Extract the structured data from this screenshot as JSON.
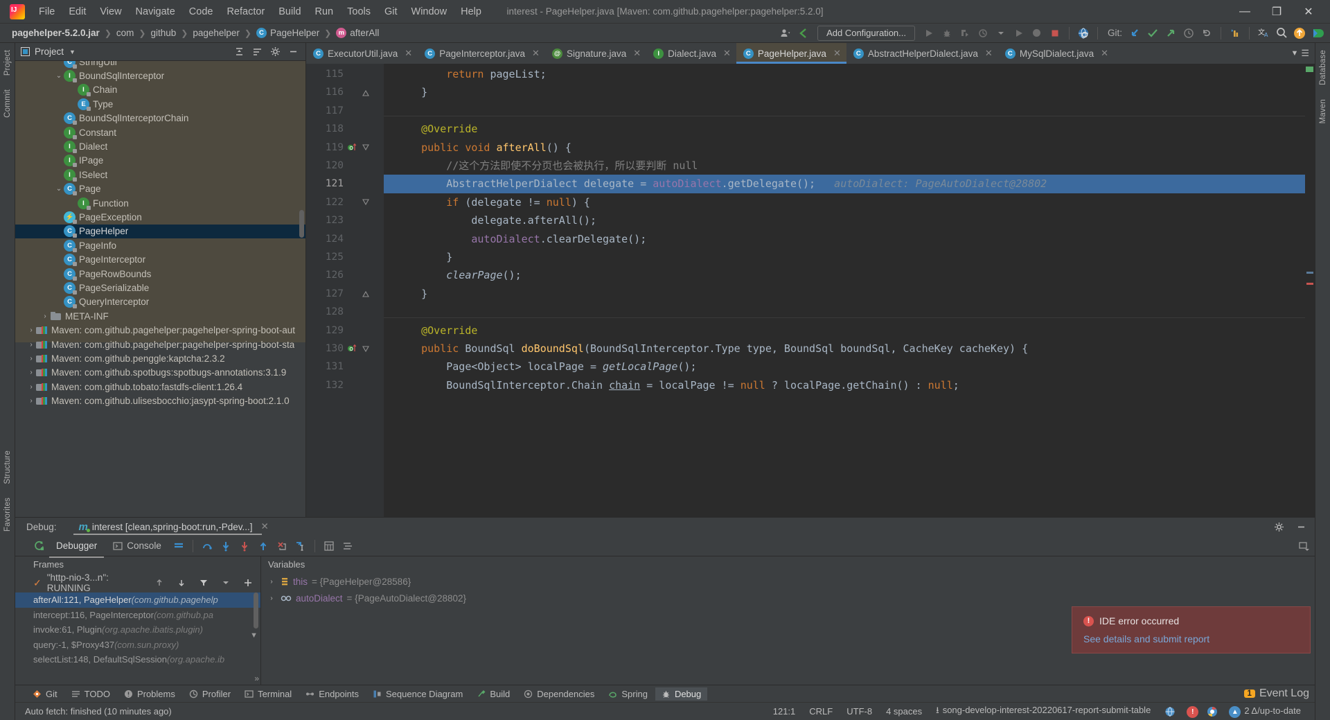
{
  "window": {
    "title": "interest - PageHelper.java [Maven: com.github.pagehelper:pagehelper:5.2.0]",
    "minimize": "—",
    "maximize": "❐",
    "close": "✕"
  },
  "menu": [
    "File",
    "Edit",
    "View",
    "Navigate",
    "Code",
    "Refactor",
    "Build",
    "Run",
    "Tools",
    "Git",
    "Window",
    "Help"
  ],
  "breadcrumb": [
    {
      "label": "pagehelper-5.2.0.jar",
      "icon": "none",
      "bold": true
    },
    {
      "label": "com",
      "icon": "none",
      "bold": false
    },
    {
      "label": "github",
      "icon": "none",
      "bold": false
    },
    {
      "label": "pagehelper",
      "icon": "none",
      "bold": false
    },
    {
      "label": "PageHelper",
      "icon": "class",
      "bold": false
    },
    {
      "label": "afterAll",
      "icon": "method",
      "bold": false
    }
  ],
  "toolbar": {
    "add_configuration": "Add Configuration...",
    "git_label": "Git:"
  },
  "project_panel": {
    "title": "Project",
    "tree": [
      {
        "label": "StringUtil",
        "indent": 3,
        "icon": "C",
        "arrow": "",
        "selected": false,
        "clipped": true
      },
      {
        "label": "BoundSqlInterceptor",
        "indent": 3,
        "icon": "I",
        "arrow": "v",
        "selected": false
      },
      {
        "label": "Chain",
        "indent": 4,
        "icon": "I",
        "arrow": "",
        "selected": false
      },
      {
        "label": "Type",
        "indent": 4,
        "icon": "E",
        "arrow": "",
        "selected": false
      },
      {
        "label": "BoundSqlInterceptorChain",
        "indent": 3,
        "icon": "C",
        "arrow": "",
        "selected": false
      },
      {
        "label": "Constant",
        "indent": 3,
        "icon": "I",
        "arrow": "",
        "selected": false
      },
      {
        "label": "Dialect",
        "indent": 3,
        "icon": "I",
        "arrow": "",
        "selected": false
      },
      {
        "label": "IPage",
        "indent": 3,
        "icon": "I",
        "arrow": "",
        "selected": false
      },
      {
        "label": "ISelect",
        "indent": 3,
        "icon": "I",
        "arrow": "",
        "selected": false
      },
      {
        "label": "Page",
        "indent": 3,
        "icon": "C",
        "arrow": "v",
        "selected": false
      },
      {
        "label": "Function",
        "indent": 4,
        "icon": "I",
        "arrow": "",
        "selected": false
      },
      {
        "label": "PageException",
        "indent": 3,
        "icon": "X",
        "arrow": "",
        "selected": false
      },
      {
        "label": "PageHelper",
        "indent": 3,
        "icon": "C",
        "arrow": "",
        "selected": true
      },
      {
        "label": "PageInfo",
        "indent": 3,
        "icon": "C",
        "arrow": "",
        "selected": false
      },
      {
        "label": "PageInterceptor",
        "indent": 3,
        "icon": "C",
        "arrow": "",
        "selected": false
      },
      {
        "label": "PageRowBounds",
        "indent": 3,
        "icon": "C",
        "arrow": "",
        "selected": false
      },
      {
        "label": "PageSerializable",
        "indent": 3,
        "icon": "C",
        "arrow": "",
        "selected": false
      },
      {
        "label": "QueryInterceptor",
        "indent": 3,
        "icon": "C",
        "arrow": "",
        "selected": false
      },
      {
        "label": "META-INF",
        "indent": 2,
        "icon": "folder",
        "arrow": ">",
        "selected": false
      },
      {
        "label": "Maven: com.github.pagehelper:pagehelper-spring-boot-aut",
        "indent": 1,
        "icon": "maven",
        "arrow": ">",
        "selected": false
      },
      {
        "label": "Maven: com.github.pagehelper:pagehelper-spring-boot-sta",
        "indent": 1,
        "icon": "maven",
        "arrow": ">",
        "selected": false
      },
      {
        "label": "Maven: com.github.penggle:kaptcha:2.3.2",
        "indent": 1,
        "icon": "maven",
        "arrow": ">",
        "selected": false
      },
      {
        "label": "Maven: com.github.spotbugs:spotbugs-annotations:3.1.9",
        "indent": 1,
        "icon": "maven",
        "arrow": ">",
        "selected": false
      },
      {
        "label": "Maven: com.github.tobato:fastdfs-client:1.26.4",
        "indent": 1,
        "icon": "maven",
        "arrow": ">",
        "selected": false
      },
      {
        "label": "Maven: com.github.ulisesbocchio:jasypt-spring-boot:2.1.0",
        "indent": 1,
        "icon": "maven",
        "arrow": ">",
        "selected": false
      }
    ]
  },
  "left_strip": [
    "Project",
    "Commit"
  ],
  "left_strip_bottom": [
    "Structure",
    "Favorites"
  ],
  "right_strip": [
    "Database",
    "Maven"
  ],
  "editor": {
    "tabs": [
      {
        "label": "ExecutorUtil.java",
        "icon": "C",
        "active": false
      },
      {
        "label": "PageInterceptor.java",
        "icon": "C",
        "active": false
      },
      {
        "label": "Signature.java",
        "icon": "A",
        "active": false
      },
      {
        "label": "Dialect.java",
        "icon": "I",
        "active": false
      },
      {
        "label": "PageHelper.java",
        "icon": "C",
        "active": true
      },
      {
        "label": "AbstractHelperDialect.java",
        "icon": "C",
        "active": false
      },
      {
        "label": "MySqlDialect.java",
        "icon": "C",
        "active": false
      }
    ],
    "lines": [
      {
        "n": "115",
        "indent": 2,
        "tokens": [
          {
            "t": "return ",
            "c": "kw"
          },
          {
            "t": "pageList",
            "c": "id"
          },
          {
            "t": ";",
            "c": "id"
          }
        ]
      },
      {
        "n": "116",
        "indent": 1,
        "tokens": [
          {
            "t": "}",
            "c": "id"
          }
        ],
        "fold": "end"
      },
      {
        "n": "117",
        "indent": 0,
        "tokens": []
      },
      {
        "n": "118",
        "indent": 1,
        "tokens": [
          {
            "t": "@Override",
            "c": "ann"
          }
        ],
        "separator_above": true
      },
      {
        "n": "119",
        "indent": 1,
        "tokens": [
          {
            "t": "public ",
            "c": "kw"
          },
          {
            "t": "void ",
            "c": "kw"
          },
          {
            "t": "afterAll",
            "c": "mth"
          },
          {
            "t": "() {",
            "c": "id"
          }
        ],
        "gutter_mark": "override",
        "fold": "start"
      },
      {
        "n": "120",
        "indent": 2,
        "tokens": [
          {
            "t": "//这个方法即使不分页也会被执行，所以要判断 null",
            "c": "cmt"
          }
        ]
      },
      {
        "n": "121",
        "indent": 2,
        "highlight": true,
        "tokens": [
          {
            "t": "AbstractHelperDialect delegate = ",
            "c": "typ"
          },
          {
            "t": "autoDialect",
            "c": "fld"
          },
          {
            "t": ".",
            "c": "id"
          },
          {
            "t": "getDelegate",
            "c": "id"
          },
          {
            "t": "();",
            "c": "id"
          }
        ],
        "inline_debug": "autoDialect: PageAutoDialect@28802"
      },
      {
        "n": "122",
        "indent": 2,
        "tokens": [
          {
            "t": "if ",
            "c": "kw"
          },
          {
            "t": "(delegate != ",
            "c": "id"
          },
          {
            "t": "null",
            "c": "kw"
          },
          {
            "t": ") {",
            "c": "id"
          }
        ],
        "fold": "start"
      },
      {
        "n": "123",
        "indent": 3,
        "tokens": [
          {
            "t": "delegate.afterAll();",
            "c": "id"
          }
        ]
      },
      {
        "n": "124",
        "indent": 3,
        "tokens": [
          {
            "t": "autoDialect",
            "c": "fld"
          },
          {
            "t": ".clearDelegate();",
            "c": "id"
          }
        ]
      },
      {
        "n": "125",
        "indent": 2,
        "tokens": [
          {
            "t": "}",
            "c": "id"
          }
        ]
      },
      {
        "n": "126",
        "indent": 2,
        "tokens": [
          {
            "t": "clearPage",
            "c": "ital"
          },
          {
            "t": "();",
            "c": "id"
          }
        ]
      },
      {
        "n": "127",
        "indent": 1,
        "tokens": [
          {
            "t": "}",
            "c": "id"
          }
        ],
        "fold": "end"
      },
      {
        "n": "128",
        "indent": 0,
        "tokens": []
      },
      {
        "n": "129",
        "indent": 1,
        "tokens": [
          {
            "t": "@Override",
            "c": "ann"
          }
        ],
        "separator_above": true
      },
      {
        "n": "130",
        "indent": 1,
        "tokens": [
          {
            "t": "public ",
            "c": "kw"
          },
          {
            "t": "BoundSql ",
            "c": "typ"
          },
          {
            "t": "doBoundSql",
            "c": "mth"
          },
          {
            "t": "(BoundSqlInterceptor.Type type, BoundSql boundSql, CacheKey cacheKey) {",
            "c": "id"
          }
        ],
        "gutter_mark": "override",
        "fold": "start"
      },
      {
        "n": "131",
        "indent": 2,
        "tokens": [
          {
            "t": "Page<Object> localPage = ",
            "c": "typ"
          },
          {
            "t": "getLocalPage",
            "c": "ital"
          },
          {
            "t": "();",
            "c": "id"
          }
        ]
      },
      {
        "n": "132",
        "indent": 2,
        "tokens": [
          {
            "t": "BoundSqlInterceptor.Chain ",
            "c": "typ"
          },
          {
            "t": "chain",
            "c": "ul"
          },
          {
            "t": " = localPage != ",
            "c": "id"
          },
          {
            "t": "null",
            "c": "kw"
          },
          {
            "t": " ? localPage.getChain() : ",
            "c": "id"
          },
          {
            "t": "null",
            "c": "kw"
          },
          {
            "t": ";",
            "c": "id"
          }
        ]
      }
    ]
  },
  "debug": {
    "label": "Debug:",
    "session": "interest [clean,spring-boot:run,-Pdev...]",
    "tabs": [
      {
        "label": "Debugger",
        "active": true
      },
      {
        "label": "Console",
        "active": false
      }
    ],
    "frames_title": "Frames",
    "variables_title": "Variables",
    "thread": "\"http-nio-3...n\": RUNNING",
    "frames": [
      {
        "method": "afterAll:121, PageHelper",
        "pkg": "(com.github.pagehelp",
        "selected": true
      },
      {
        "method": "intercept:116, PageInterceptor",
        "pkg": "(com.github.pa",
        "selected": false
      },
      {
        "method": "invoke:61, Plugin",
        "pkg": "(org.apache.ibatis.plugin)",
        "selected": false
      },
      {
        "method": "query:-1, $Proxy437",
        "pkg": "(com.sun.proxy)",
        "selected": false
      },
      {
        "method": "selectList:148, DefaultSqlSession",
        "pkg": "(org.apache.ib",
        "selected": false
      }
    ],
    "variables": [
      {
        "name": "this",
        "value": "= {PageHelper@28586}",
        "icon": "obj"
      },
      {
        "name": "autoDialect",
        "value": "= {PageAutoDialect@28802}",
        "icon": "chain"
      }
    ]
  },
  "error_balloon": {
    "title": "IDE error occurred",
    "link": "See details and submit report"
  },
  "bottom_tabs": [
    {
      "label": "Git",
      "icon": "git"
    },
    {
      "label": "TODO",
      "icon": "todo"
    },
    {
      "label": "Problems",
      "icon": "problems"
    },
    {
      "label": "Profiler",
      "icon": "profiler"
    },
    {
      "label": "Terminal",
      "icon": "terminal"
    },
    {
      "label": "Endpoints",
      "icon": "endpoints"
    },
    {
      "label": "Sequence Diagram",
      "icon": "sequence"
    },
    {
      "label": "Build",
      "icon": "build"
    },
    {
      "label": "Dependencies",
      "icon": "dependencies"
    },
    {
      "label": "Spring",
      "icon": "spring"
    },
    {
      "label": "Debug",
      "icon": "debug",
      "active": true
    }
  ],
  "event_log": {
    "count": "1",
    "label": "Event Log"
  },
  "statusbar": {
    "message": "Auto fetch: finished (10 minutes ago)",
    "caret": "121:1",
    "line_separator": "CRLF",
    "encoding": "UTF-8",
    "indent": "4 spaces",
    "branch": "song-develop-interest-20220617-report-submit-table",
    "updates": "2 Δ/up-to-date"
  }
}
